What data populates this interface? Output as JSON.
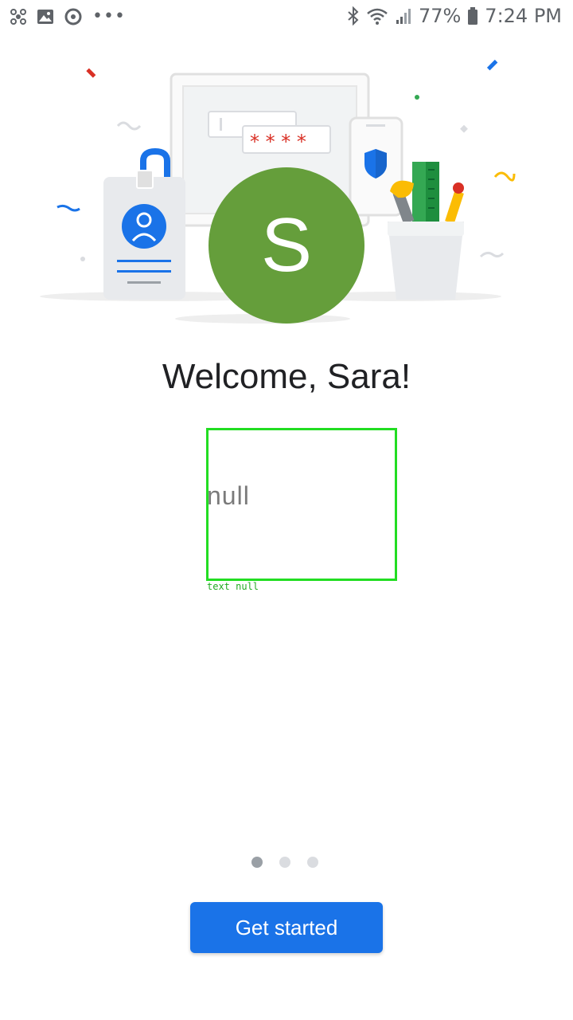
{
  "status_bar": {
    "battery": "77%",
    "time": "7:24 PM"
  },
  "avatar": {
    "initial": "S",
    "color": "#659e3b"
  },
  "welcome": {
    "title": "Welcome, Sara!"
  },
  "overlay": {
    "value": "null",
    "caption": "text null"
  },
  "pager": {
    "count": 3,
    "active": 1
  },
  "cta": {
    "label": "Get started",
    "color": "#1a73e8"
  }
}
